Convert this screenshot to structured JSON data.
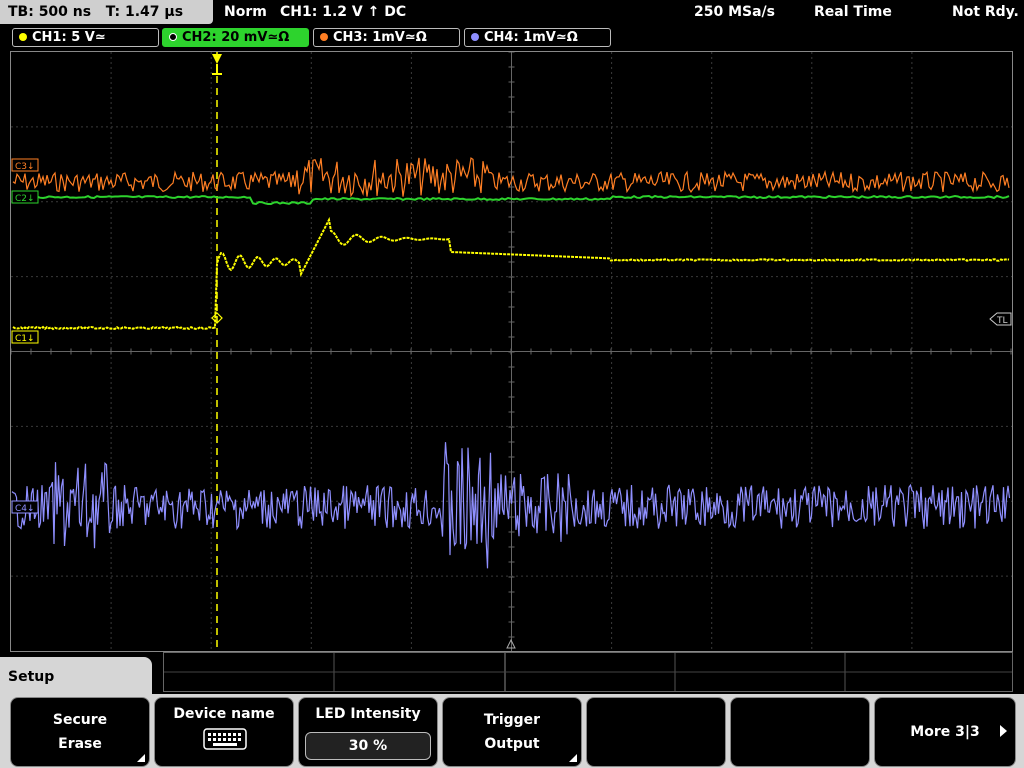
{
  "topbar": {
    "timebase": "TB: 500 ns",
    "trigger_time": "T: 1.47 µs",
    "mode": "Norm",
    "trigger_info": "CH1: 1.2 V ↑ DC",
    "sample_rate": "250 MSa/s",
    "acq_mode": "Real Time",
    "status": "Not Rdy."
  },
  "channels": [
    {
      "label": "CH1: 5 V≃",
      "color": "#ffff00"
    },
    {
      "label": "CH2: 20 mV≃Ω",
      "color": "#2dd32d"
    },
    {
      "label": "CH3: 1mV≃Ω",
      "color": "#ff7f24"
    },
    {
      "label": "CH4: 1mV≃Ω",
      "color": "#8f8fff"
    }
  ],
  "markers": {
    "c1": "C1↓",
    "c2": "C2↓",
    "c3": "C3↓",
    "c4": "C4↓",
    "tl": "TL"
  },
  "menu": {
    "title": "Setup",
    "softkeys": [
      {
        "line1": "Secure",
        "line2": "Erase"
      },
      {
        "line1": "Device name",
        "icon": "keyboard-icon"
      },
      {
        "line1": "LED Intensity",
        "value": "30 %"
      },
      {
        "line1": "Trigger",
        "line2": "Output"
      },
      {
        "line1": "",
        "line2": ""
      },
      {
        "line1": "",
        "line2": ""
      },
      {
        "line1": "More 3|3"
      }
    ]
  }
}
